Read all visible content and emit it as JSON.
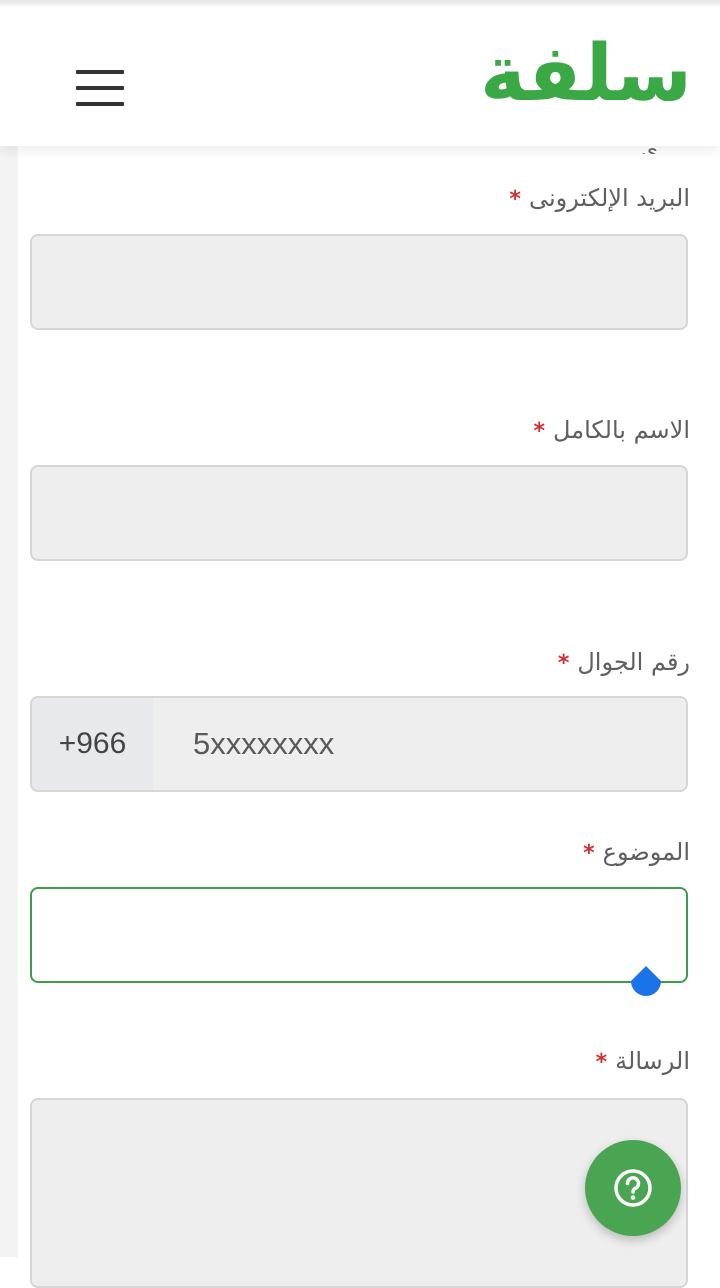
{
  "header": {
    "logo_text": "سلفة",
    "menu_icon": "hamburger-menu-icon",
    "brand_color": "#3aa845"
  },
  "form": {
    "partial_label": "ي",
    "required_marker": "*",
    "email": {
      "label": "البريد الإلكترونى",
      "value": ""
    },
    "full_name": {
      "label": "الاسم بالكامل",
      "value": ""
    },
    "phone": {
      "label": "رقم الجوال",
      "prefix": "+966",
      "placeholder": "5xxxxxxxx",
      "value": ""
    },
    "subject": {
      "label": "الموضوع",
      "value": ""
    },
    "message": {
      "label": "الرسالة",
      "value": ""
    }
  },
  "help_button": {
    "icon": "question-circle-icon",
    "color": "#4aa552"
  },
  "colors": {
    "required_star": "#d32f2f",
    "focus_border": "#3f9d4a",
    "text_cursor_handle": "#1a73e8"
  }
}
